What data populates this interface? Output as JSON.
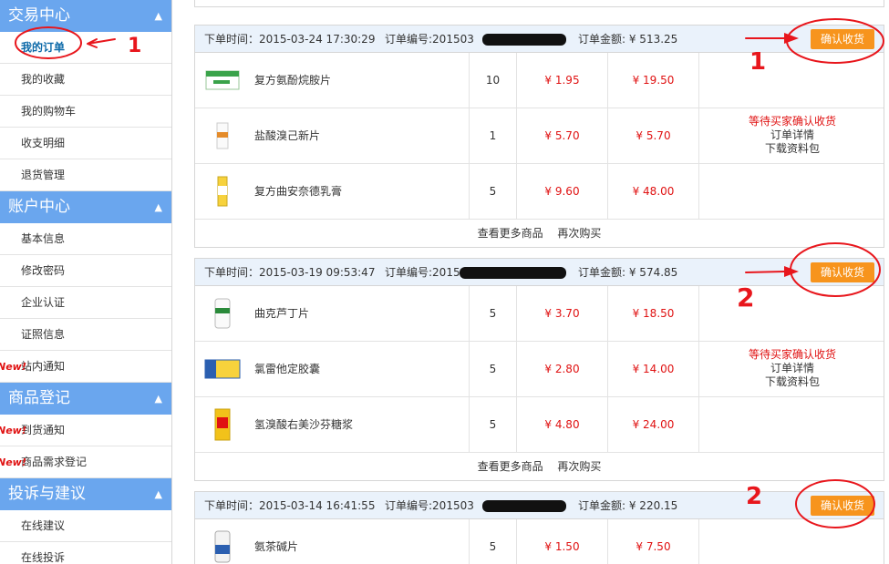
{
  "sidebar": {
    "sections": [
      {
        "title": "交易中心",
        "items": [
          {
            "label": "我的订单",
            "active": true
          },
          {
            "label": "我的收藏"
          },
          {
            "label": "我的购物车"
          },
          {
            "label": "收支明细"
          },
          {
            "label": "退货管理"
          }
        ]
      },
      {
        "title": "账户中心",
        "items": [
          {
            "label": "基本信息"
          },
          {
            "label": "修改密码"
          },
          {
            "label": "企业认证"
          },
          {
            "label": "证照信息"
          },
          {
            "label": "站内通知",
            "new": "New!"
          }
        ]
      },
      {
        "title": "商品登记",
        "items": [
          {
            "label": "到货通知",
            "new": "New!"
          },
          {
            "label": "商品需求登记",
            "new": "New!"
          }
        ]
      },
      {
        "title": "投诉与建议",
        "items": [
          {
            "label": "在线建议"
          },
          {
            "label": "在线投诉"
          }
        ]
      }
    ]
  },
  "orders": [
    {
      "time_label": "下单时间：2015-03-24 17:30:29",
      "num_label": "订单编号:201503",
      "amount_label": "订单金额: ¥ 513.25",
      "confirm": "确认收货",
      "status": "等待买家确认收货",
      "detail": "订单详情",
      "download": "下载资料包",
      "items": [
        {
          "name": "复方氨酚烷胺片",
          "qty": "10",
          "price": "¥ 1.95",
          "total": "¥ 19.50"
        },
        {
          "name": "盐酸溴己新片",
          "qty": "1",
          "price": "¥ 5.70",
          "total": "¥ 5.70"
        },
        {
          "name": "复方曲安奈德乳膏",
          "qty": "5",
          "price": "¥ 9.60",
          "total": "¥ 48.00"
        }
      ],
      "more": "查看更多商品",
      "rebuy": "再次购买"
    },
    {
      "time_label": "下单时间：2015-03-19 09:53:47",
      "num_label": "订单编号:2015",
      "amount_label": "订单金额: ¥ 574.85",
      "confirm": "确认收货",
      "status": "等待买家确认收货",
      "detail": "订单详情",
      "download": "下载资料包",
      "items": [
        {
          "name": "曲克芦丁片",
          "qty": "5",
          "price": "¥ 3.70",
          "total": "¥ 18.50"
        },
        {
          "name": "氯雷他定胶囊",
          "qty": "5",
          "price": "¥ 2.80",
          "total": "¥ 14.00"
        },
        {
          "name": "氢溴酸右美沙芬糖浆",
          "qty": "5",
          "price": "¥ 4.80",
          "total": "¥ 24.00"
        }
      ],
      "more": "查看更多商品",
      "rebuy": "再次购买"
    },
    {
      "time_label": "下单时间：2015-03-14 16:41:55",
      "num_label": "订单编号:201503",
      "amount_label": "订单金额: ¥ 220.15",
      "confirm": "确认收货",
      "items": [
        {
          "name": "氨茶碱片",
          "qty": "5",
          "price": "¥ 1.50",
          "total": "¥ 7.50"
        }
      ]
    }
  ],
  "annotations": {
    "one": "1",
    "two": "2"
  },
  "colors": {
    "sidebar_head": "#6aa6ee",
    "accent_orange": "#f7941d",
    "price_red": "#e01212",
    "order_head_bg": "#eaf2fb",
    "annotation_red": "#e8161c"
  }
}
